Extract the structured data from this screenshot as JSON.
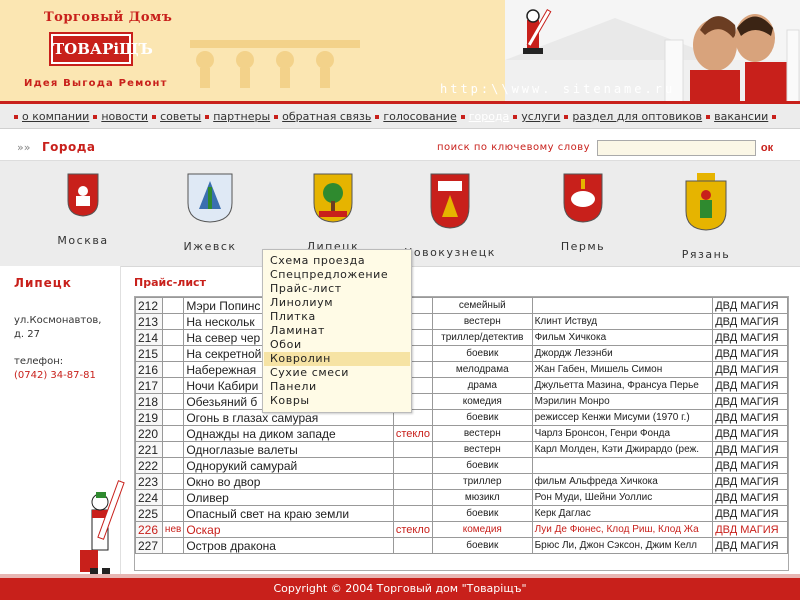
{
  "brand": {
    "name_top": "Торговый Домъ",
    "logo": "ТОВАРіЩЪ",
    "tagline": "Идея Выгода Ремонт",
    "url": "http:\\\\www. sitename.ru"
  },
  "nav": {
    "items": [
      {
        "label": "о компании",
        "active": false
      },
      {
        "label": "новости",
        "active": false
      },
      {
        "label": "советы",
        "active": false
      },
      {
        "label": "партнеры",
        "active": false
      },
      {
        "label": "обратная связь",
        "active": false
      },
      {
        "label": "голосование",
        "active": false
      },
      {
        "label": "города",
        "active": true
      },
      {
        "label": "услуги",
        "active": false
      },
      {
        "label": "раздел для оптовиков",
        "active": false
      },
      {
        "label": "вакансии",
        "active": false
      }
    ]
  },
  "section": {
    "title": "Города",
    "search_label": "поиск по ключевому слову",
    "search_value": "",
    "search_button": "ок"
  },
  "cities": [
    {
      "name": "Москва",
      "icon": "moscow-coat-icon",
      "color": "#c8201b"
    },
    {
      "name": "Ижевск",
      "icon": "izhevsk-coat-icon",
      "color": "#3a6fb0"
    },
    {
      "name": "Липецк",
      "icon": "lipetsk-coat-icon",
      "color": "#2f8a2f"
    },
    {
      "name": "Новокузнецк",
      "icon": "novokuznetsk-coat-icon",
      "color": "#c8201b"
    },
    {
      "name": "Пермь",
      "icon": "perm-coat-icon",
      "color": "#c8201b"
    },
    {
      "name": "Рязань",
      "icon": "ryazan-coat-icon",
      "color": "#e6b400"
    }
  ],
  "sidebar": {
    "city": "Липецк",
    "address": "ул.Космонавтов, д. 27",
    "phone_label": "телефон:",
    "phone": "(0742) 34-87-81"
  },
  "main": {
    "title": "Прайс-лист"
  },
  "dropdown": {
    "items": [
      "Схема проезда",
      "Спецпредложение",
      "Прайс-лист",
      "Линолиум",
      "Плитка",
      "Ламинат",
      "Обои",
      "Ковролин",
      "Сухие смеси",
      "Панели",
      "Ковры"
    ],
    "hover_index": 7
  },
  "table": {
    "rows": [
      {
        "num": "212",
        "new": "",
        "title": "Мэри Попинс",
        "mat": "",
        "genre": "семейный",
        "actors": "",
        "label": "ДВД МАГИЯ",
        "red": false
      },
      {
        "num": "213",
        "new": "",
        "title": "На нескольк",
        "mat": "",
        "genre": "вестерн",
        "actors": "Клинт Иствуд",
        "label": "ДВД МАГИЯ",
        "red": false
      },
      {
        "num": "214",
        "new": "",
        "title": "На север чер",
        "mat": "",
        "genre": "триллер/детектив",
        "actors": "Фильм Хичкока",
        "label": "ДВД МАГИЯ",
        "red": false
      },
      {
        "num": "215",
        "new": "",
        "title": "На секретной",
        "mat": "",
        "genre": "боевик",
        "actors": "Джордж Лезэнби",
        "label": "ДВД МАГИЯ",
        "red": false
      },
      {
        "num": "216",
        "new": "",
        "title": "Набережная",
        "mat": "",
        "genre": "мелодрама",
        "actors": "Жан Габен, Мишель Симон",
        "label": "ДВД МАГИЯ",
        "red": false
      },
      {
        "num": "217",
        "new": "",
        "title": "Ночи Кабири",
        "mat": "",
        "genre": "драма",
        "actors": "Джульетта Мазина, Франсуа Перье",
        "label": "ДВД МАГИЯ",
        "red": false
      },
      {
        "num": "218",
        "new": "",
        "title": "Обезьяний б",
        "mat": "",
        "genre": "комедия",
        "actors": "Мэрилин Монро",
        "label": "ДВД МАГИЯ",
        "red": false
      },
      {
        "num": "219",
        "new": "",
        "title": "Огонь в глазах самурая",
        "mat": "",
        "genre": "боевик",
        "actors": "режиссер Кенжи Мисуми (1970 г.)",
        "label": "ДВД МАГИЯ",
        "red": false
      },
      {
        "num": "220",
        "new": "",
        "title": "Однажды на диком западе",
        "mat": "стекло",
        "genre": "вестерн",
        "actors": "Чарлз Бронсон, Генри Фонда",
        "label": "ДВД МАГИЯ",
        "red": false
      },
      {
        "num": "221",
        "new": "",
        "title": "Одноглазые валеты",
        "mat": "",
        "genre": "вестерн",
        "actors": "Карл Молден, Кэти Джирардо (реж.",
        "label": "ДВД МАГИЯ",
        "red": false
      },
      {
        "num": "222",
        "new": "",
        "title": "Однорукий самурай",
        "mat": "",
        "genre": "боевик",
        "actors": "",
        "label": "ДВД МАГИЯ",
        "red": false
      },
      {
        "num": "223",
        "new": "",
        "title": "Окно во двор",
        "mat": "",
        "genre": "триллер",
        "actors": "фильм Альфреда Хичкока",
        "label": "ДВД МАГИЯ",
        "red": false
      },
      {
        "num": "224",
        "new": "",
        "title": "Оливер",
        "mat": "",
        "genre": "мюзикл",
        "actors": "Рон Муди, Шейни Уоллис",
        "label": "ДВД МАГИЯ",
        "red": false
      },
      {
        "num": "225",
        "new": "",
        "title": "Опасный свет на краю земли",
        "mat": "",
        "genre": "боевик",
        "actors": "Керк Даглас",
        "label": "ДВД МАГИЯ",
        "red": false
      },
      {
        "num": "226",
        "new": "нев",
        "title": "Оскар",
        "mat": "стекло",
        "genre": "комедия",
        "actors": "Луи Де Фюнес, Клод Риш, Клод Жа",
        "label": "ДВД МАГИЯ",
        "red": true
      },
      {
        "num": "227",
        "new": "",
        "title": "Остров дракона",
        "mat": "",
        "genre": "боевик",
        "actors": "Брюс Ли, Джон Сэксон, Джим Келл",
        "label": "ДВД МАГИЯ",
        "red": false
      }
    ]
  },
  "footer": {
    "text": "Copyright © 2004 Торговый дом \"Товаріщъ\""
  }
}
